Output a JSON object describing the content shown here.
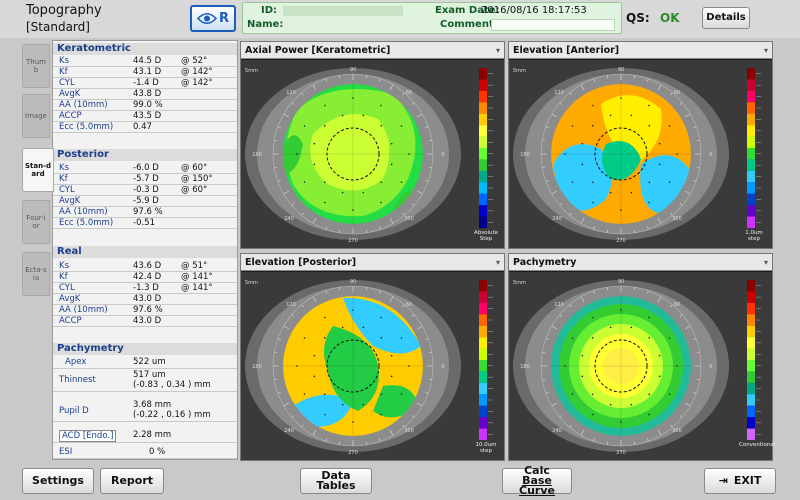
{
  "header": {
    "title": "Topography",
    "subtitle": "[Standard]",
    "eye_label": "R",
    "id_label": "ID:",
    "id_value": "",
    "name_label": "Name:",
    "exam_date_label": "Exam Date:",
    "exam_date_value": "2016/08/16 18:17:53",
    "comment_label": "Comment:",
    "qs_label": "QS:",
    "qs_value": "OK",
    "details_label": "Details"
  },
  "left_tabs": [
    {
      "label": "Thumb",
      "active": false
    },
    {
      "label": "Image",
      "active": false
    },
    {
      "label": "Stan-dard",
      "active": true
    },
    {
      "label": "Four-ior",
      "active": false
    },
    {
      "label": "Ecta-sia",
      "active": false
    }
  ],
  "keratometric": {
    "title": "Keratometric",
    "rows": [
      {
        "label": "Ks",
        "value": "44.5 D",
        "axis": "@ 52°"
      },
      {
        "label": "Kf",
        "value": "43.1 D",
        "axis": "@ 142°"
      },
      {
        "label": "CYL",
        "value": "-1.4 D",
        "axis": "@ 142°"
      },
      {
        "label": "AvgK",
        "value": "43.8 D",
        "axis": ""
      },
      {
        "label": "AA (10mm)",
        "value": "99.0 %",
        "axis": ""
      },
      {
        "label": "ACCP",
        "value": "43.5 D",
        "axis": ""
      },
      {
        "label": "Ecc (5.0mm)",
        "value": "0.47",
        "axis": ""
      }
    ]
  },
  "posterior": {
    "title": "Posterior",
    "rows": [
      {
        "label": "Ks",
        "value": "-6.0 D",
        "axis": "@ 60°"
      },
      {
        "label": "Kf",
        "value": "-5.7 D",
        "axis": "@ 150°"
      },
      {
        "label": "CYL",
        "value": "-0.3 D",
        "axis": "@ 60°"
      },
      {
        "label": "AvgK",
        "value": "-5.9 D",
        "axis": ""
      },
      {
        "label": "AA (10mm)",
        "value": "97.6 %",
        "axis": ""
      },
      {
        "label": "Ecc (5.0mm)",
        "value": "-0.51",
        "axis": ""
      }
    ]
  },
  "real": {
    "title": "Real",
    "rows": [
      {
        "label": "Ks",
        "value": "43.6 D",
        "axis": "@ 51°"
      },
      {
        "label": "Kf",
        "value": "42.4 D",
        "axis": "@ 141°"
      },
      {
        "label": "CYL",
        "value": "-1.3 D",
        "axis": "@ 141°"
      },
      {
        "label": "AvgK",
        "value": "43.0 D",
        "axis": ""
      },
      {
        "label": "AA (10mm)",
        "value": "97.6 %",
        "axis": ""
      },
      {
        "label": "ACCP",
        "value": "43.0 D",
        "axis": ""
      }
    ]
  },
  "pachymetry_data": {
    "title": "Pachymetry",
    "apex_label": "Apex",
    "apex_value": "522 um",
    "thinnest_label": "Thinnest",
    "thinnest_value": "517 um",
    "thinnest_coords": "(-0.83 , 0.34 )  mm",
    "pupil_label": "Pupil D",
    "pupil_value": "3.68 mm",
    "pupil_coords": "(-0.22 , 0.16 )  mm",
    "acd_label": "ACD [Endo.]",
    "acd_value": "2.28 mm",
    "esi_label": "ESI",
    "esi_value": "0 %"
  },
  "maps": [
    {
      "title": "Axial Power [Keratometric]",
      "scale_label": "Absolute Step",
      "palette": "axial"
    },
    {
      "title": "Elevation [Anterior]",
      "scale_label": "1.0um step",
      "palette": "elev"
    },
    {
      "title": "Elevation [Posterior]",
      "scale_label": "10.0um step",
      "palette": "elev"
    },
    {
      "title": "Pachymetry",
      "scale_label": "Conventional",
      "palette": "pachy"
    }
  ],
  "map_tick_labels": {
    "top": "90",
    "bottom": "270",
    "left": "180",
    "right": "0",
    "diag_tl": "120",
    "diag_tr": "60",
    "diag_bl": "240",
    "diag_br": "300",
    "mm_label": "5mm"
  },
  "colors": {
    "accent": "#1c5fb8",
    "section_title": "#1b3f8a",
    "qs_ok": "#2a8a2a",
    "patient_bg": "#e0f3df"
  },
  "footer": {
    "settings_label": "Settings",
    "report_label": "Report",
    "data_tables_label": "Data Tables",
    "calc_label_1": "Calc",
    "calc_label_2": "Base Curve",
    "exit_label": "EXIT"
  }
}
